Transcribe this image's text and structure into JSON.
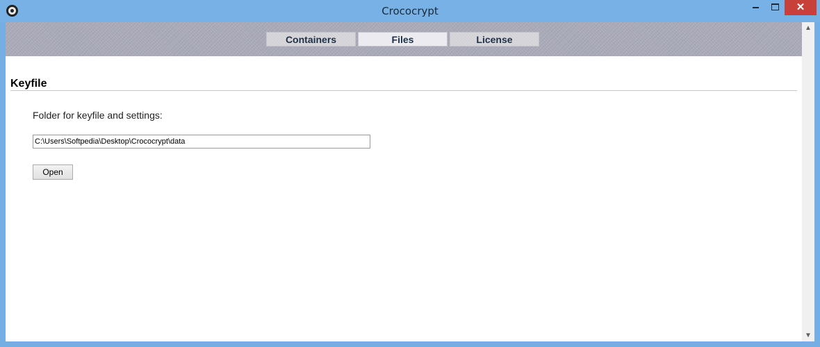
{
  "window": {
    "title": "Crococrypt",
    "close_glyph": "✕"
  },
  "tabs": [
    {
      "label": "Containers",
      "active": false
    },
    {
      "label": "Files",
      "active": true
    },
    {
      "label": "License",
      "active": false
    }
  ],
  "keyfile": {
    "heading": "Keyfile",
    "folder_label": "Folder for keyfile and settings:",
    "folder_path": "C:\\Users\\Softpedia\\Desktop\\Crococrypt\\data",
    "open_label": "Open"
  },
  "scrollbar": {
    "up_glyph": "▲",
    "down_glyph": "▼"
  },
  "colors": {
    "titlebar": "#78b1e6",
    "close_button": "#c7413a",
    "tab_band": "#a9aab8",
    "tab_text": "#1e3048"
  }
}
